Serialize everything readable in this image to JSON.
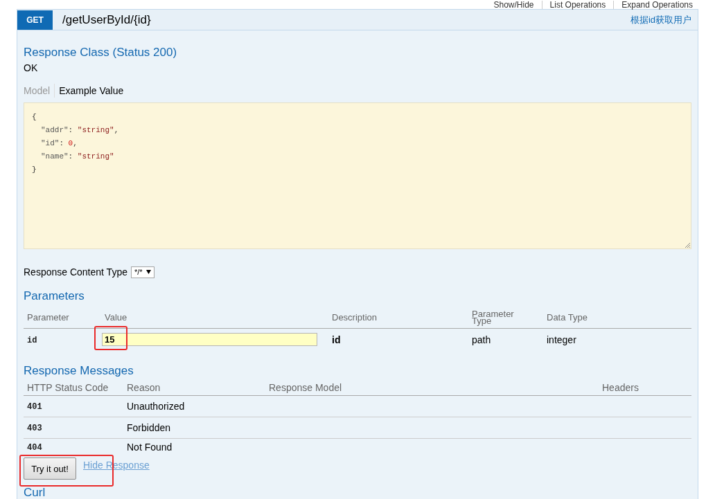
{
  "top_links": [
    "Show/Hide",
    "List Operations",
    "Expand Operations"
  ],
  "operation": {
    "method": "GET",
    "path": "/getUserById/{id}",
    "summary": "根据id获取用户"
  },
  "response_class": {
    "heading": "Response Class (Status 200)",
    "status_text": "OK",
    "tabs": [
      {
        "label": "Model",
        "selected": false
      },
      {
        "label": "Example Value",
        "selected": true
      }
    ],
    "example_value": [
      {
        "tokens": [
          {
            "kind": "punct",
            "text": "{"
          }
        ],
        "children": [
          {
            "tokens": [
              {
                "kind": "key",
                "text": "\"addr\""
              },
              {
                "kind": "punct",
                "text": ": "
              },
              {
                "kind": "string",
                "text": "\"string\""
              },
              {
                "kind": "punct",
                "text": ","
              }
            ]
          },
          {
            "tokens": [
              {
                "kind": "key",
                "text": "\"id\""
              },
              {
                "kind": "punct",
                "text": ": "
              },
              {
                "kind": "number",
                "text": "0"
              },
              {
                "kind": "punct",
                "text": ","
              }
            ]
          },
          {
            "tokens": [
              {
                "kind": "key",
                "text": "\"name\""
              },
              {
                "kind": "punct",
                "text": ": "
              },
              {
                "kind": "string",
                "text": "\"string\""
              }
            ]
          }
        ]
      },
      {
        "tokens": [
          {
            "kind": "punct",
            "text": "}"
          }
        ]
      }
    ]
  },
  "response_content_type": {
    "label": "Response Content Type",
    "value": "*/*"
  },
  "parameters": {
    "heading": "Parameters",
    "columns": [
      "Parameter",
      "Value",
      "Description",
      "Parameter Type",
      "Data Type"
    ],
    "rows": [
      {
        "name": "id",
        "value": "15",
        "description": "id",
        "parameter_type": "path",
        "data_type": "integer",
        "highlighted": true
      }
    ]
  },
  "response_messages": {
    "heading": "Response Messages",
    "columns": [
      "HTTP Status Code",
      "Reason",
      "Response Model",
      "Headers"
    ],
    "rows": [
      {
        "code": "401",
        "reason": "Unauthorized"
      },
      {
        "code": "403",
        "reason": "Forbidden"
      },
      {
        "code": "404",
        "reason": "Not Found"
      }
    ]
  },
  "try_button": {
    "label": "Try it out!",
    "highlighted": true
  },
  "hide_response_link": "Hide Response",
  "curl_heading": "Curl"
}
